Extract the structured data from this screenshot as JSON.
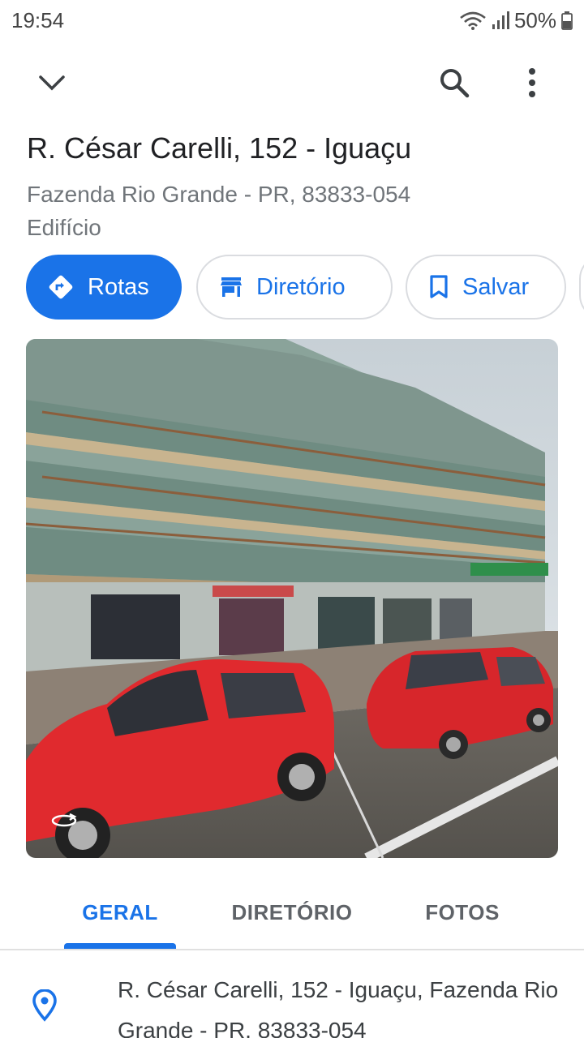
{
  "status_bar": {
    "time": "19:54",
    "battery": "50%"
  },
  "place": {
    "title": "R. César Carelli, 152 - Iguaçu",
    "subtitle": "Fazenda Rio Grande - PR, 83833-054",
    "type": "Edifício"
  },
  "actions": {
    "routes": "Rotas",
    "directory": "Diretório",
    "save": "Salvar"
  },
  "tabs": [
    {
      "label": "GERAL",
      "selected": true
    },
    {
      "label": "DIRETÓRIO",
      "selected": false
    },
    {
      "label": "FOTOS",
      "selected": false
    }
  ],
  "address": {
    "text": "R. César Carelli, 152 - Iguaçu, Fazenda Rio Grande - PR, 83833-054"
  },
  "colors": {
    "accent": "#1a73e8",
    "secondary_text": "#70757a"
  }
}
